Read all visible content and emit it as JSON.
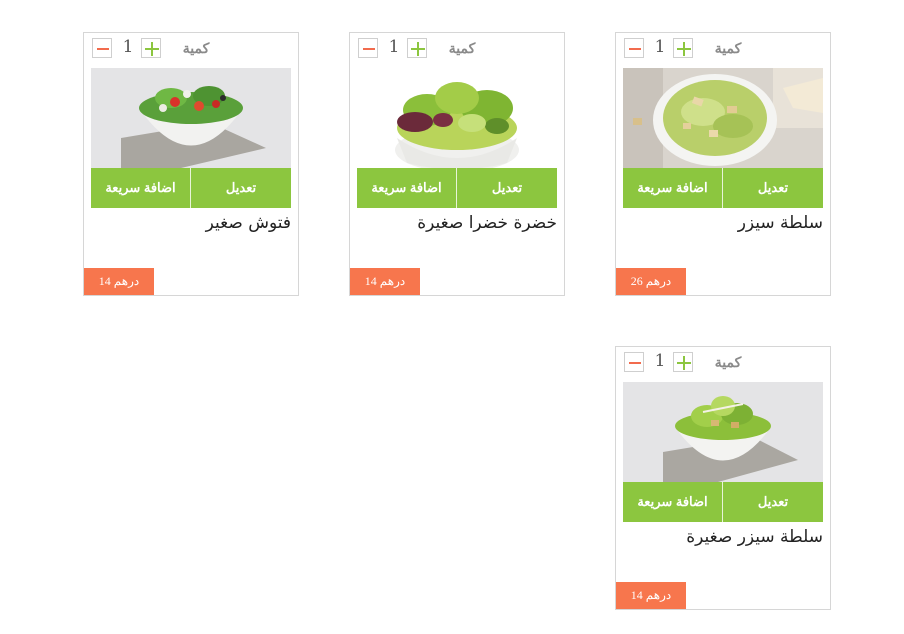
{
  "cards": [
    {
      "qty_label": "كمية",
      "qty_value": "1",
      "image_icon": "caesar-salad-photo",
      "edit_label": "تعديل",
      "quick_add_label": "اضافة سريعة",
      "name": "سلطة سيزر",
      "price": "درهم 26"
    },
    {
      "qty_label": "كمية",
      "qty_value": "1",
      "image_icon": "green-salad-photo",
      "edit_label": "تعديل",
      "quick_add_label": "اضافة سريعة",
      "name": "خضرة خضرا صغيرة",
      "price": "درهم 14"
    },
    {
      "qty_label": "كمية",
      "qty_value": "1",
      "image_icon": "fattoush-photo",
      "edit_label": "تعديل",
      "quick_add_label": "اضافة سريعة",
      "name": "فتوش صغير",
      "price": "درهم 14"
    },
    {
      "qty_label": "كمية",
      "qty_value": "1",
      "image_icon": "small-caesar-salad-photo",
      "edit_label": "تعديل",
      "quick_add_label": "اضافة سريعة",
      "name": "سلطة سيزر صغيرة",
      "price": "درهم 14"
    }
  ],
  "colors": {
    "accent_green": "#8cc63f",
    "price_orange": "#f7764d",
    "minus_red": "#f26b4d"
  }
}
